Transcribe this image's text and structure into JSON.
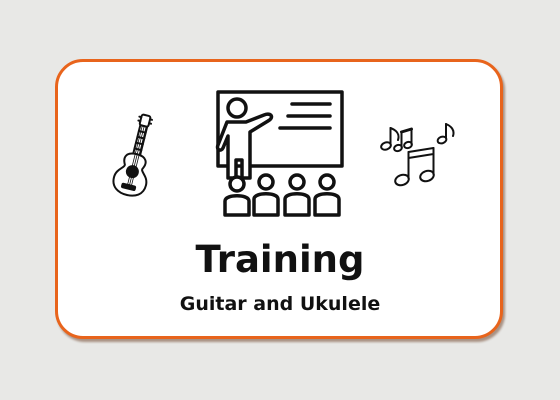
{
  "card": {
    "title": "Training",
    "subtitle": "Guitar and Ukulele"
  },
  "icons": {
    "left": "guitar-icon",
    "center": "teacher-classroom-icon",
    "right": "music-notes-icon"
  },
  "colors": {
    "background": "#e8e8e6",
    "card_border": "#e8641c",
    "card_fill": "#ffffff",
    "text": "#111111"
  }
}
